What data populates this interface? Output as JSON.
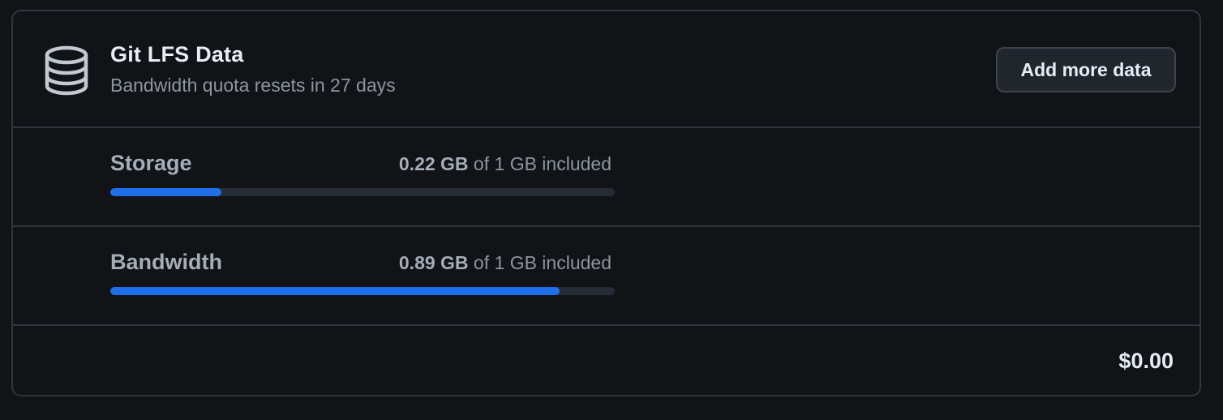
{
  "header": {
    "icon": "database-icon",
    "title": "Git LFS Data",
    "subtitle": "Bandwidth quota resets in 27 days",
    "add_button_label": "Add more data"
  },
  "rows": [
    {
      "label": "Storage",
      "used": "0.22 GB",
      "of_text": " of 1 GB included",
      "fraction": 0.22
    },
    {
      "label": "Bandwidth",
      "used": "0.89 GB",
      "of_text": " of 1 GB included",
      "fraction": 0.89
    }
  ],
  "footer": {
    "total": "$0.00"
  },
  "colors": {
    "accent": "#1f6feb",
    "background": "#111317",
    "border": "#30363d"
  }
}
